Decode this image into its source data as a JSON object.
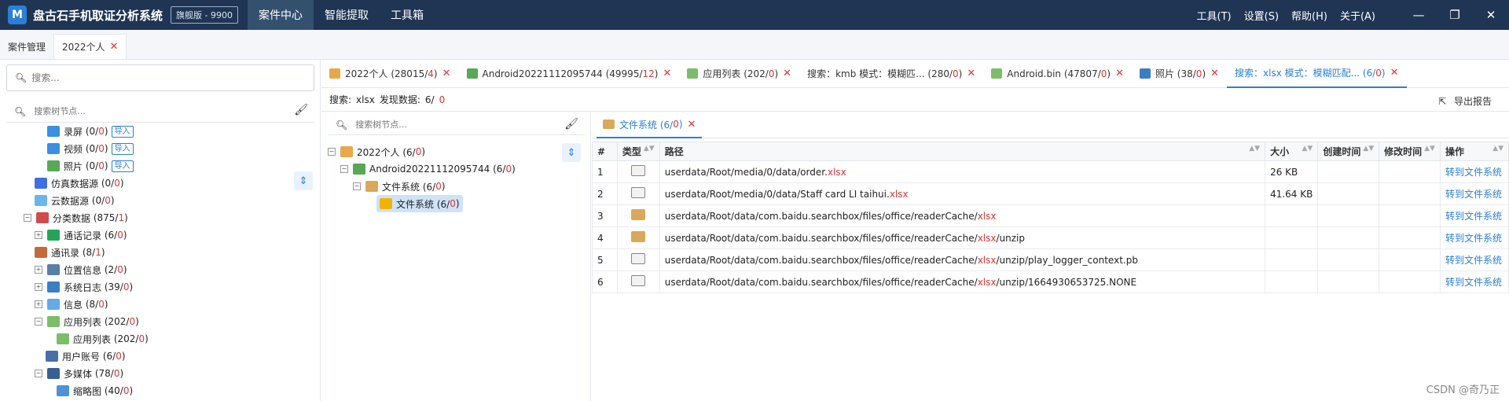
{
  "titlebar": {
    "logo_letter": "M",
    "app_name": "盘古石手机取证分析系统",
    "edition": "旗舰版 - 9900",
    "menu": [
      "案件中心",
      "智能提取",
      "工具箱"
    ],
    "right_menu": [
      "工具(T)",
      "设置(S)",
      "帮助(H)",
      "关于(A)"
    ],
    "controls": [
      "—",
      "❐",
      "✕"
    ]
  },
  "top_tabs": [
    "案件管理",
    "2022个人"
  ],
  "left": {
    "search_placeholder": "搜索...",
    "tree_search_placeholder": "搜索树节点...",
    "import_label": "导入",
    "items": [
      {
        "label": "录屏",
        "count": "0/",
        "red": "0",
        "close": ")",
        "import": true
      },
      {
        "label": "视频",
        "count": "0/",
        "red": "0",
        "close": ")",
        "import": true
      },
      {
        "label": "照片",
        "count": "0/",
        "red": "0",
        "close": ")",
        "import": true
      },
      {
        "label": "仿真数据源",
        "count": "0/",
        "red": "0",
        "close": ")"
      },
      {
        "label": "云数据源",
        "count": "0/",
        "red": "0",
        "close": ")"
      },
      {
        "label": "分类数据",
        "count": "875/",
        "red": "1",
        "close": ")"
      },
      {
        "label": "通话记录",
        "count": "6/",
        "red": "0",
        "close": ")"
      },
      {
        "label": "通讯录",
        "count": "8/",
        "red": "1",
        "close": ")"
      },
      {
        "label": "位置信息",
        "count": "2/",
        "red": "0",
        "close": ")"
      },
      {
        "label": "系统日志",
        "count": "39/",
        "red": "0",
        "close": ")"
      },
      {
        "label": "信息",
        "count": "8/",
        "red": "0",
        "close": ")"
      },
      {
        "label": "应用列表",
        "count": "202/",
        "red": "0",
        "close": ")"
      },
      {
        "label": "应用列表",
        "count": "202/",
        "red": "0",
        "close": ")"
      },
      {
        "label": "用户账号",
        "count": "6/",
        "red": "0",
        "close": ")"
      },
      {
        "label": "多媒体",
        "count": "78/",
        "red": "0",
        "close": ")"
      },
      {
        "label": "缩略图",
        "count": "40/",
        "red": "0",
        "close": ")"
      }
    ]
  },
  "case_tabs": [
    {
      "label": "2022个人 (28015/",
      "red": "4",
      "close": ")"
    },
    {
      "label": "Android20221112095744 (49995/",
      "red": "12",
      "close": ")"
    },
    {
      "label": "应用列表 (202/",
      "red": "0",
      "close": ")"
    },
    {
      "label": "搜索：kmb  模式：模糊匹... (280/",
      "red": "0",
      "close": ")"
    },
    {
      "label": "Android.bin (47807/",
      "red": "0",
      "close": ")"
    },
    {
      "label": "照片  (38/",
      "red": "0",
      "close": ")"
    },
    {
      "label": "搜索：xlsx  模式：模糊匹配... (6/",
      "red": "0",
      "close": ")"
    }
  ],
  "infobar": {
    "search_label": "搜索:",
    "keyword": "xlsx",
    "found_label": "发现数据:",
    "found": "6/",
    "found_red": "0",
    "export": "导出报告"
  },
  "midtree": {
    "placeholder": "搜索树节点...",
    "nodes": [
      {
        "label": "2022个人 (6/",
        "red": "0",
        "close": ")"
      },
      {
        "label": "Android20221112095744 (6/",
        "red": "0",
        "close": ")"
      },
      {
        "label": "文件系统 (6/",
        "red": "0",
        "close": ")"
      },
      {
        "label": "文件系统 (6/",
        "red": "0",
        "close": ")"
      }
    ]
  },
  "content_tab": {
    "label": "文件系统 (6/",
    "red": "0",
    "close": ")"
  },
  "table": {
    "headers": [
      "#",
      "类型",
      "路径",
      "大小",
      "创建时间",
      "修改时间",
      "操作"
    ],
    "rows": [
      {
        "n": "1",
        "type": "file",
        "pre": "userdata/Root/media/0/data/order.",
        "hl": "xlsx",
        "post": "",
        "size": "26 KB",
        "action": "转到文件系统"
      },
      {
        "n": "2",
        "type": "file",
        "pre": "userdata/Root/media/0/data/Staff card LI taihui.",
        "hl": "xlsx",
        "post": "",
        "size": "41.64 KB",
        "action": "转到文件系统"
      },
      {
        "n": "3",
        "type": "folder",
        "pre": "userdata/Root/data/com.baidu.searchbox/files/office/readerCache/",
        "hl": "xlsx",
        "post": "",
        "size": "",
        "action": "转到文件系统"
      },
      {
        "n": "4",
        "type": "folder",
        "pre": "userdata/Root/data/com.baidu.searchbox/files/office/readerCache/",
        "hl": "xlsx",
        "post": "/unzip",
        "size": "",
        "action": "转到文件系统"
      },
      {
        "n": "5",
        "type": "file",
        "pre": "userdata/Root/data/com.baidu.searchbox/files/office/readerCache/",
        "hl": "xlsx",
        "post": "/unzip/play_logger_context.pb",
        "size": "",
        "action": "转到文件系统"
      },
      {
        "n": "6",
        "type": "file",
        "pre": "userdata/Root/data/com.baidu.searchbox/files/office/readerCache/",
        "hl": "xlsx",
        "post": "/unzip/1664930653725.NONE",
        "size": "",
        "action": "转到文件系统"
      }
    ]
  },
  "watermark": "CSDN @奇乃正",
  "colors": {
    "titlebar": "#1f3553",
    "accent": "#2b7fd6",
    "highlight": "#e23636"
  }
}
